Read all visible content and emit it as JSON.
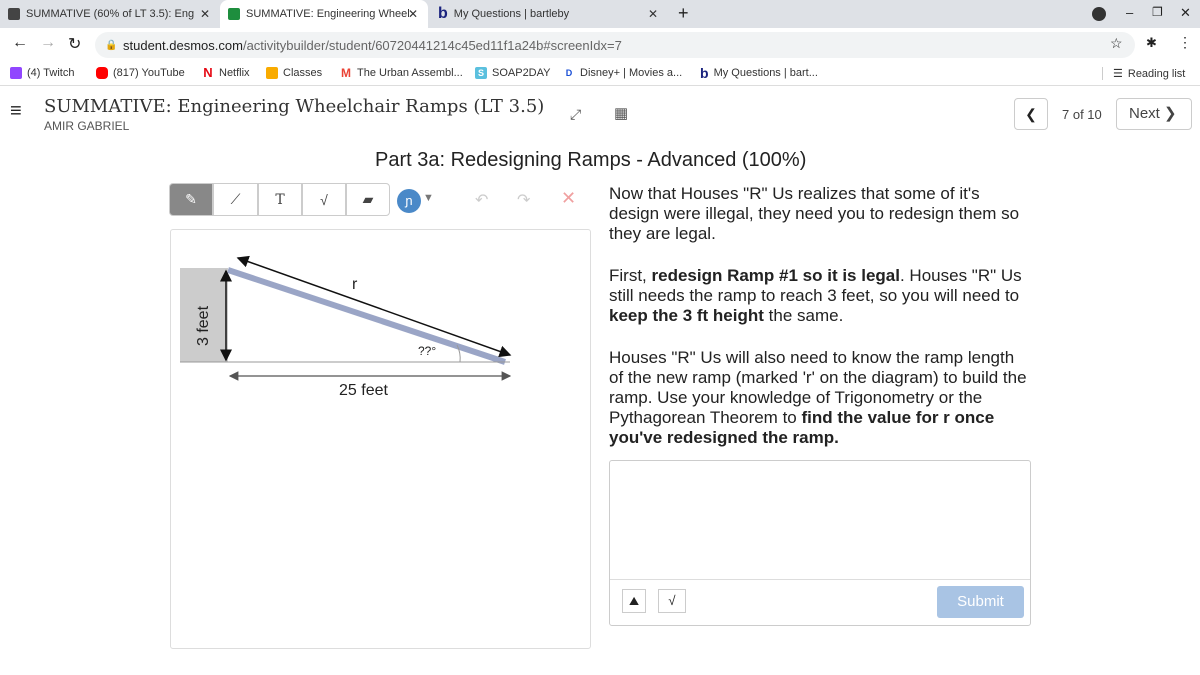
{
  "browser": {
    "tabs": [
      {
        "label": "SUMMATIVE (60% of LT 3.5): Eng"
      },
      {
        "label": "SUMMATIVE: Engineering Wheel"
      },
      {
        "label": "My Questions | bartleby"
      }
    ],
    "url_domain": "student.desmos.com",
    "url_path": "/activitybuilder/student/60720441214c45ed11f1a24b#screenIdx=7",
    "bookmarks": [
      {
        "label": "(4) Twitch"
      },
      {
        "label": "(817) YouTube"
      },
      {
        "label": "Netflix"
      },
      {
        "label": "Classes"
      },
      {
        "label": "The Urban Assembl..."
      },
      {
        "label": "SOAP2DAY"
      },
      {
        "label": "Disney+ | Movies a..."
      },
      {
        "label": "My Questions | bart..."
      }
    ],
    "reading_list": "Reading list"
  },
  "header": {
    "title": "SUMMATIVE: Engineering Wheelchair Ramps (LT 3.5)",
    "student": "AMIR GABRIEL",
    "page": "7 of 10",
    "next": "Next"
  },
  "content": {
    "heading": "Part 3a: Redesigning Ramps - Advanced (100%)",
    "diagram": {
      "r": "r",
      "angle": "??°",
      "base": "25 feet",
      "height": "3 feet"
    },
    "p1": "Now that Houses \"R\" Us realizes that some of it's design were illegal, they need you to redesign them so they are legal.",
    "p2a": "First, ",
    "p2b": "redesign Ramp #1 so it is legal",
    "p2c": ".  Houses \"R\" Us still needs the ramp to reach 3 feet, so you will need to ",
    "p2d": "keep the 3 ft height",
    "p2e": " the same.",
    "p3a": "Houses \"R\" Us will also need to know the ramp length of the new ramp (marked 'r' on the diagram) to build the ramp.  Use your knowledge of Trigonometry or the Pythagorean Theorem to ",
    "p3b": "find the value for r once you've redesigned the ramp",
    ".": ".",
    "p3c": ".",
    "submit": "Submit",
    "tool_text": "T",
    "tool_sqrt": "√"
  },
  "colors": {
    "ramp": "#9aa5c6",
    "accent": "#4a89c8",
    "submit": "#a9c4e4"
  }
}
